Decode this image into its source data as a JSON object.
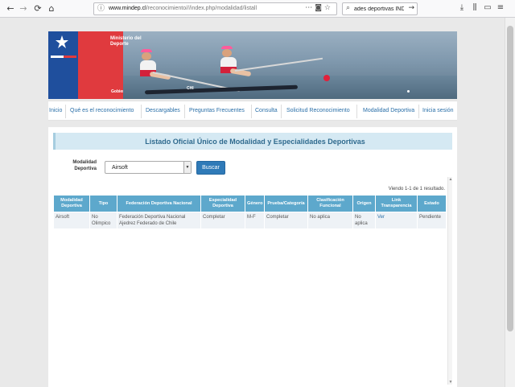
{
  "browser": {
    "back": "←",
    "forward": "→",
    "reload": "⟳",
    "home": "⌂",
    "url_host": "www.mindep.cl",
    "url_path": "/reconocimiento///index.php/modalidad/listall",
    "search_text": "ades deportivas IND",
    "tools": [
      "⤓",
      "⫼",
      "▭",
      "≡"
    ]
  },
  "banner": {
    "ministry": "Ministerio del Deporte",
    "government": "Gobierno de Chile",
    "boat_label": "CHI"
  },
  "nav": {
    "items": [
      "Inicio",
      "Qué es el reconocimiento",
      "Descargables",
      "Preguntas Frecuentes",
      "Consulta",
      "Solicitud Reconocimiento",
      "Modalidad Deportiva",
      "Inicia sesión"
    ]
  },
  "page": {
    "title": "Listado Oficial Único de Modalidad y Especialidades Deportivas",
    "filter_label": "Modalidad Deportiva",
    "filter_value": "Airsoft",
    "search_button": "Buscar",
    "summary": "Viendo 1-1 de 1 resultado."
  },
  "table": {
    "headers": [
      "Modalidad Deportiva",
      "Tipo",
      "Federación Deportiva Nacional",
      "Especialidad Deportiva",
      "Género",
      "Prueba/Categoría",
      "Clasificación Funcional",
      "Origen",
      "Link Transparencia",
      "Estado"
    ],
    "rows": [
      [
        "Airsoft",
        "No Olimpico",
        "Federación Deportiva Nacional Ajedrez Federado de Chile",
        "Completar",
        "M-F",
        "Completar",
        "No aplica",
        "No aplica",
        "Ver",
        "Pendiente"
      ]
    ]
  },
  "colors": {
    "gov_blue": "#1f4f9d",
    "gov_red": "#e03a3e",
    "header_blue": "#5da8cc",
    "link_blue": "#2a6fa8",
    "button_blue": "#2f7ab8"
  }
}
